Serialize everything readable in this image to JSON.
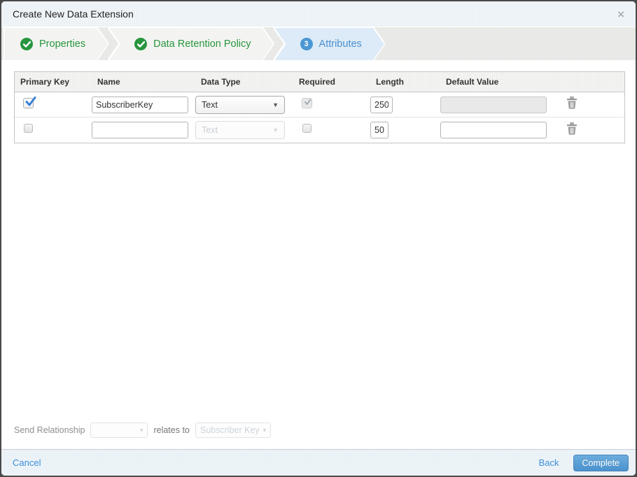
{
  "window": {
    "title": "Create New Data Extension",
    "close_icon": "×"
  },
  "wizard": {
    "steps": [
      {
        "label": "Properties",
        "state": "complete"
      },
      {
        "label": "Data Retention Policy",
        "state": "complete"
      },
      {
        "label": "Attributes",
        "state": "active",
        "number": "3"
      }
    ]
  },
  "attributes_table": {
    "headers": {
      "primary_key": "Primary Key",
      "name": "Name",
      "data_type": "Data Type",
      "required": "Required",
      "length": "Length",
      "default_value": "Default Value"
    },
    "rows": [
      {
        "primary_key_checked": true,
        "name": "SubscriberKey",
        "data_type": "Text",
        "data_type_disabled": false,
        "required_checked": true,
        "required_disabled": true,
        "length": "250",
        "default_value": "",
        "default_value_disabled": true
      },
      {
        "primary_key_checked": false,
        "name": "",
        "data_type": "Text",
        "data_type_disabled": true,
        "required_checked": false,
        "required_disabled": false,
        "length": "50",
        "default_value": "",
        "default_value_disabled": false
      }
    ]
  },
  "send_relationship": {
    "label": "Send Relationship",
    "dropdown_value": "",
    "relates_to": "relates to",
    "target_value": "Subscriber Key",
    "caret_icon": "▾"
  },
  "footer": {
    "cancel": "Cancel",
    "back": "Back",
    "complete": "Complete"
  },
  "colors": {
    "accent_green": "#28953f",
    "accent_blue": "#4b97d3",
    "active_step_bg": "#dcebf7",
    "link_blue": "#3e8ed6",
    "complete_button_blue": "#4b92cd"
  }
}
